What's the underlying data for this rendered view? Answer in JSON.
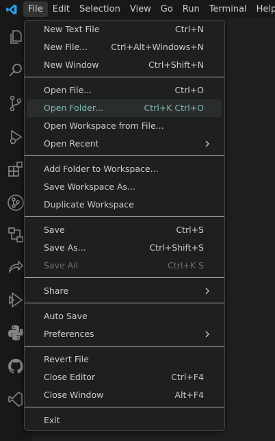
{
  "menubar": {
    "items": [
      "File",
      "Edit",
      "Selection",
      "View",
      "Go",
      "Run",
      "Terminal",
      "Help"
    ]
  },
  "activitybar": {
    "icons": [
      "explorer-icon",
      "search-icon",
      "source-control-icon",
      "run-debug-icon",
      "extensions-icon",
      "git-graph-icon",
      "remote-explorer-icon",
      "live-share-icon",
      "testing-icon",
      "python-icon",
      "github-icon",
      "remote-icon"
    ]
  },
  "file_menu": {
    "new_text_file": {
      "label": "New Text File",
      "shortcut": "Ctrl+N"
    },
    "new_file": {
      "label": "New File...",
      "shortcut": "Ctrl+Alt+Windows+N"
    },
    "new_window": {
      "label": "New Window",
      "shortcut": "Ctrl+Shift+N"
    },
    "open_file": {
      "label": "Open File...",
      "shortcut": "Ctrl+O"
    },
    "open_folder": {
      "label": "Open Folder...",
      "shortcut": "Ctrl+K Ctrl+O"
    },
    "open_workspace": {
      "label": "Open Workspace from File..."
    },
    "open_recent": {
      "label": "Open Recent"
    },
    "add_folder": {
      "label": "Add Folder to Workspace..."
    },
    "save_workspace_as": {
      "label": "Save Workspace As..."
    },
    "duplicate_workspace": {
      "label": "Duplicate Workspace"
    },
    "save": {
      "label": "Save",
      "shortcut": "Ctrl+S"
    },
    "save_as": {
      "label": "Save As...",
      "shortcut": "Ctrl+Shift+S"
    },
    "save_all": {
      "label": "Save All",
      "shortcut": "Ctrl+K S"
    },
    "share": {
      "label": "Share"
    },
    "auto_save": {
      "label": "Auto Save"
    },
    "preferences": {
      "label": "Preferences"
    },
    "revert_file": {
      "label": "Revert File"
    },
    "close_editor": {
      "label": "Close Editor",
      "shortcut": "Ctrl+F4"
    },
    "close_window": {
      "label": "Close Window",
      "shortcut": "Alt+F4"
    },
    "exit": {
      "label": "Exit"
    }
  },
  "colors": {
    "accent": "#0078d4",
    "highlight_box": "#c0282d",
    "hover_text": "#7fb7a8"
  }
}
